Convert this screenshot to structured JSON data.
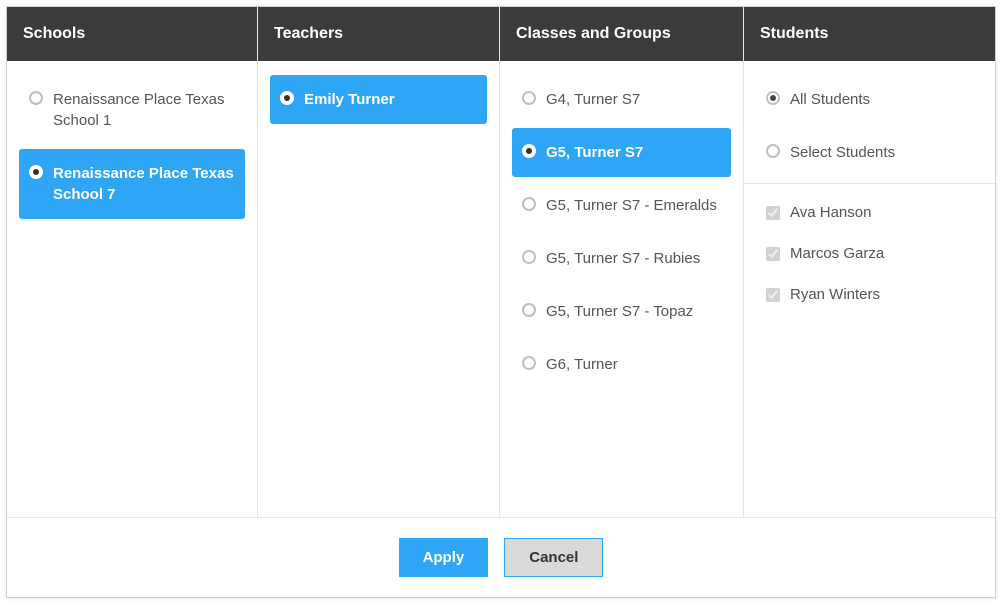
{
  "columns": {
    "schools": {
      "header": "Schools",
      "items": [
        {
          "label": "Renaissance Place Texas School 1",
          "selected": false
        },
        {
          "label": "Renaissance Place Texas School 7",
          "selected": true
        }
      ]
    },
    "teachers": {
      "header": "Teachers",
      "items": [
        {
          "label": "Emily Turner",
          "selected": true
        }
      ]
    },
    "classes": {
      "header": "Classes and Groups",
      "items": [
        {
          "label": "G4, Turner S7",
          "selected": false
        },
        {
          "label": "G5, Turner S7",
          "selected": true
        },
        {
          "label": "G5, Turner S7 - Emeralds",
          "selected": false
        },
        {
          "label": "G5, Turner S7 - Rubies",
          "selected": false
        },
        {
          "label": "G5, Turner S7 - Topaz",
          "selected": false
        },
        {
          "label": "G6, Turner",
          "selected": false
        }
      ]
    },
    "students": {
      "header": "Students",
      "mode_options": [
        {
          "label": "All Students",
          "checked": true
        },
        {
          "label": "Select Students",
          "checked": false
        }
      ],
      "students": [
        {
          "label": "Ava Hanson",
          "checked": true
        },
        {
          "label": "Marcos Garza",
          "checked": true
        },
        {
          "label": "Ryan Winters",
          "checked": true
        }
      ]
    }
  },
  "footer": {
    "apply": "Apply",
    "cancel": "Cancel"
  }
}
